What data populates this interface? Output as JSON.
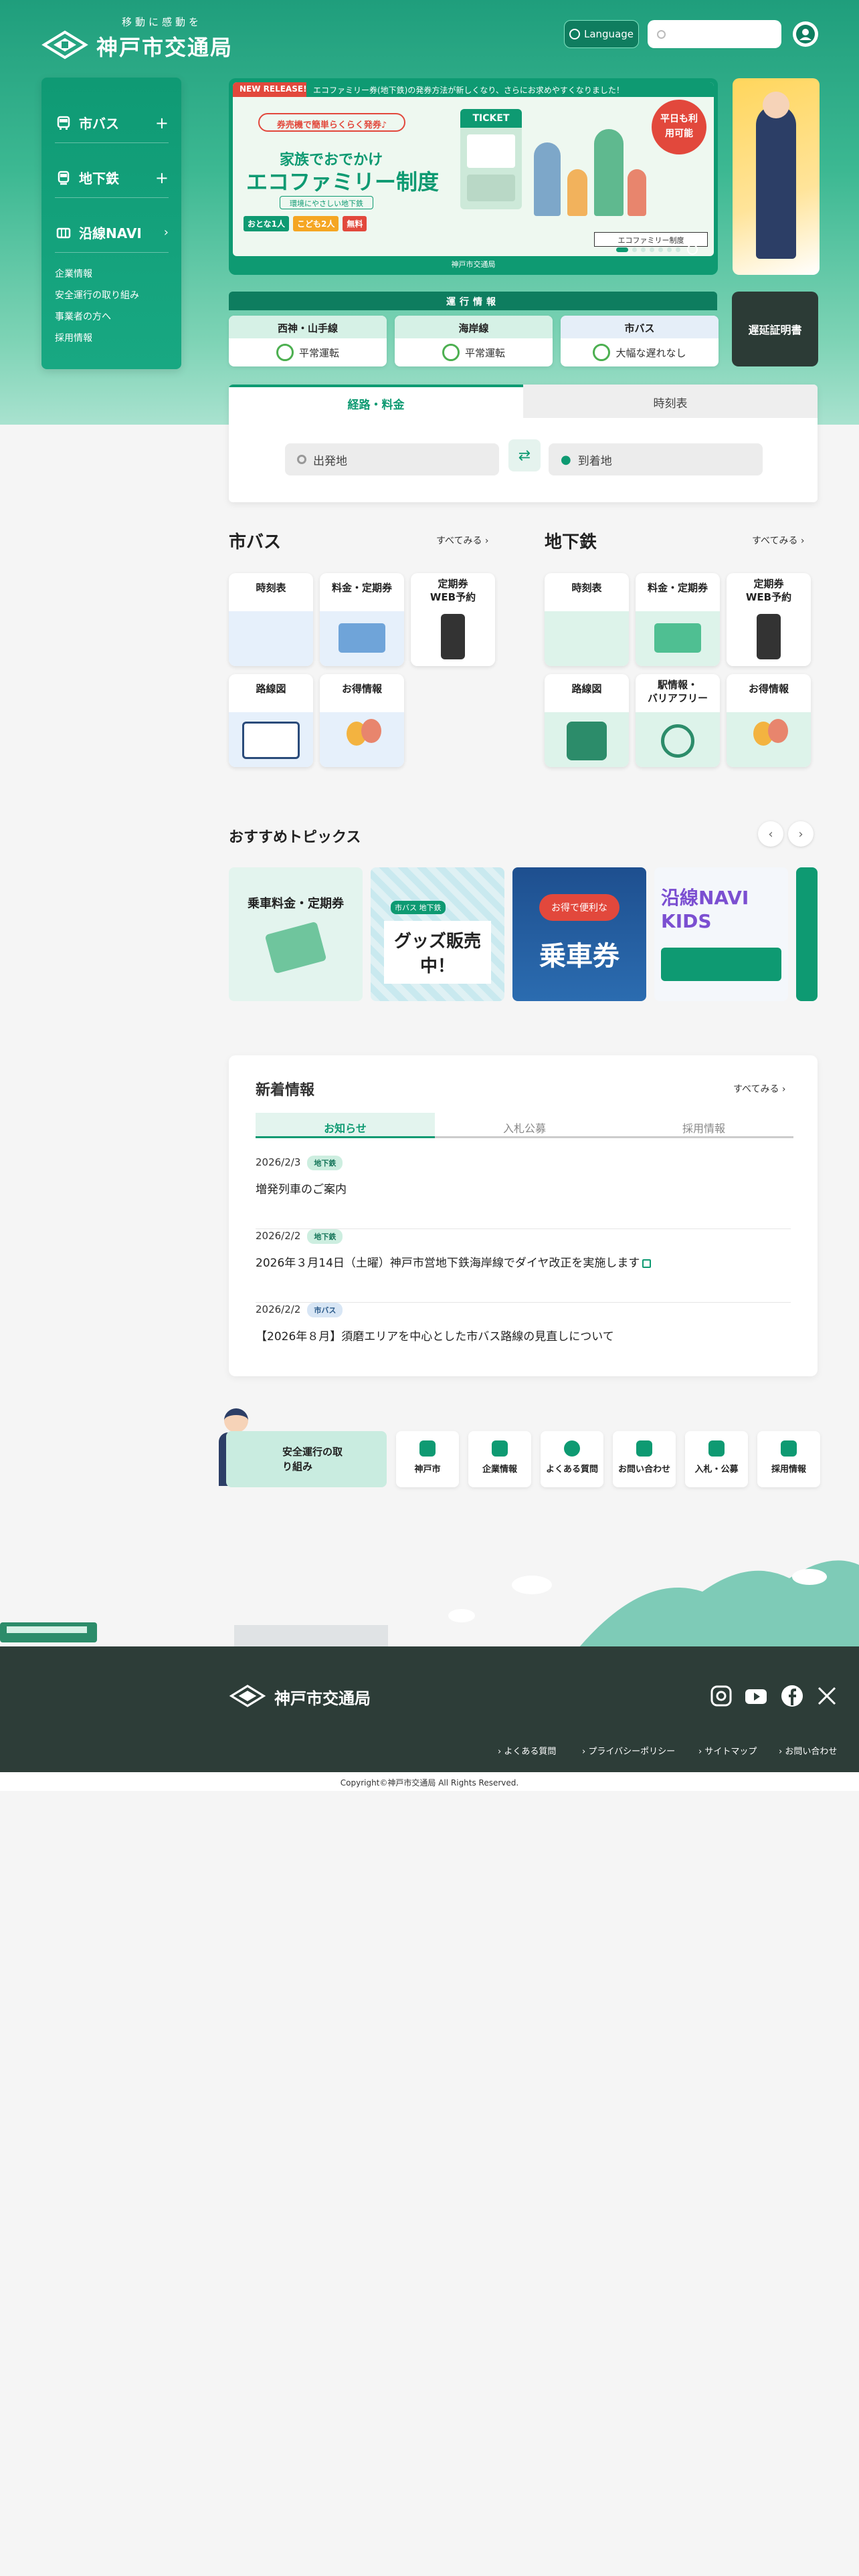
{
  "header": {
    "tagline": "移動に感動を",
    "logo_text": "神戸市交通局",
    "language_label": "Language",
    "search_placeholder": ""
  },
  "sidenav": {
    "items": [
      {
        "label": "市バス",
        "icon": "bus-icon"
      },
      {
        "label": "地下鉄",
        "icon": "train-icon"
      },
      {
        "label": "沿線NAVI",
        "icon": "map-icon"
      }
    ],
    "links": [
      "企業情報",
      "安全運行の取り組み",
      "事業者の方へ",
      "採用情報"
    ]
  },
  "banner": {
    "tag": "NEW RELEASE!",
    "headline": "エコファミリー券(地下鉄)の発券方法が新しくなり、さらにお求めやすくなりました！",
    "catch": "券売機で簡単らくらく発券♪",
    "title_small": "家族でおでかけ",
    "title_big": "エコファミリー制度",
    "sub": "環境にやさしい地下鉄",
    "ticket_label": "TICKET",
    "bubble": "平日も利用可能",
    "adult": "おとな1人",
    "child": "こども2人",
    "free": "無料",
    "button": "エコファミリー制度",
    "footer": "神戸市交通局",
    "slides": 7,
    "active_slide": 1
  },
  "operations": {
    "heading": "運行情報",
    "lines": [
      {
        "name": "西神・山手線",
        "status": "平常運転"
      },
      {
        "name": "海岸線",
        "status": "平常運転"
      },
      {
        "name": "市バス",
        "status": "大幅な遅れなし"
      }
    ],
    "delay_button": "遅延証明書"
  },
  "route": {
    "tab_route": "経路・料金",
    "tab_timetable": "時刻表",
    "from": "出発地",
    "to": "到着地"
  },
  "bus_section": {
    "title": "市バス",
    "see_all": "すべてみる",
    "tiles": [
      "時刻表",
      "料金・定期券",
      "定期券\nWEB予約",
      "路線図",
      "お得情報"
    ]
  },
  "subway_section": {
    "title": "地下鉄",
    "see_all": "すべてみる",
    "tiles": [
      "時刻表",
      "料金・定期券",
      "定期券\nWEB予約",
      "路線図",
      "駅情報・\nバリアフリー",
      "お得情報"
    ]
  },
  "topics": {
    "title": "おすすめトピックス",
    "cards": [
      {
        "text": "乗車料金・定期券"
      },
      {
        "text": "グッズ販売中！",
        "sub": "市バス 地下鉄"
      },
      {
        "text": "乗車券",
        "sub": "お得で便利な"
      },
      {
        "text": "沿線NAVI KIDS"
      }
    ]
  },
  "news": {
    "title": "新着情報",
    "see_all": "すべてみる",
    "tabs": [
      "お知らせ",
      "入札公募",
      "採用情報"
    ],
    "items": [
      {
        "date": "2026/2/3",
        "badge": "地下鉄",
        "title": "増発列車のご案内"
      },
      {
        "date": "2026/2/2",
        "badge": "地下鉄",
        "title": "2026年３月14日（土曜）神戸市営地下鉄海岸線でダイヤ改正を実施します"
      },
      {
        "date": "2026/2/2",
        "badge": "市バス",
        "title": "【2026年８月】須磨エリアを中心とした市バス路線の見直しについて"
      }
    ]
  },
  "links": {
    "safety": "安全運行の取り組み",
    "items": [
      "神戸市",
      "企業情報",
      "よくある質問",
      "お問い合わせ",
      "入札・公募",
      "採用情報"
    ]
  },
  "footer": {
    "logo_text": "神戸市交通局",
    "links": [
      "よくある質問",
      "プライバシーポリシー",
      "サイトマップ",
      "お問い合わせ"
    ],
    "copyright": "Copyright©神戸市交通局 All Rights Reserved."
  },
  "colors": {
    "brand": "#0e9a72",
    "dark": "#2d3d38",
    "accent_red": "#e2483c"
  }
}
